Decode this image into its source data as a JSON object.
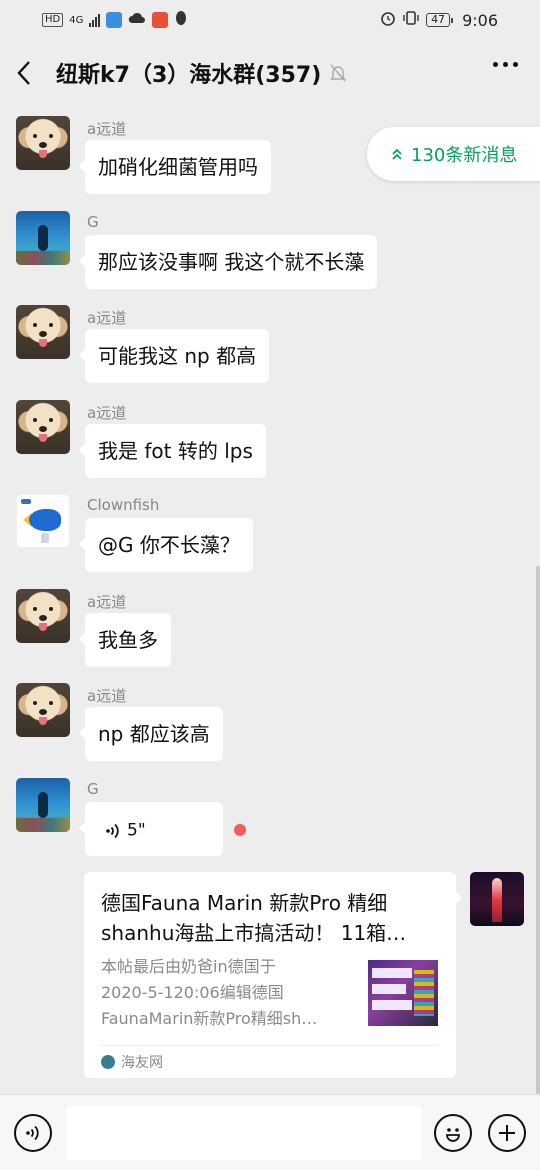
{
  "status_bar": {
    "network_badge": "HD",
    "network_type": "4G",
    "battery": "47",
    "time": "9:06"
  },
  "nav": {
    "title": "纽斯k7（3）海水群(357)"
  },
  "new_messages": {
    "label": "130条新消息"
  },
  "messages": [
    {
      "sender": "a远道",
      "avatar": "dog-avatar",
      "text": "加硝化细菌管用吗"
    },
    {
      "sender": "G",
      "avatar": "diver-avatar",
      "text": "那应该没事啊 我这个就不长藻"
    },
    {
      "sender": "a远道",
      "avatar": "dog-avatar",
      "text": "可能我这 np 都高"
    },
    {
      "sender": "a远道",
      "avatar": "dog-avatar",
      "text": "我是 fot 转的 lps"
    },
    {
      "sender": "Clownfish",
      "avatar": "fish-avatar",
      "text": "@G  你不长藻？"
    },
    {
      "sender": "a远道",
      "avatar": "dog-avatar",
      "text": "我鱼多"
    },
    {
      "sender": "a远道",
      "avatar": "dog-avatar",
      "text": "np 都应该高"
    },
    {
      "sender": "G",
      "avatar": "diver-avatar",
      "voice_duration": "5\""
    }
  ],
  "link_card": {
    "title_line1": "德国Fauna Marin 新款Pro 精细",
    "title_line2": "shanhu海盐上市搞活动！ 11箱…",
    "desc_line1": "本帖最后由奶爸in德国于",
    "desc_line2": "2020-5-120:06编辑德国",
    "desc_line3": "FaunaMarin新款Pro精细sh…",
    "source": "海友网"
  },
  "colors": {
    "accent_green": "#07a35a",
    "unread_red": "#f25d5d",
    "chat_background": "#ededed"
  }
}
